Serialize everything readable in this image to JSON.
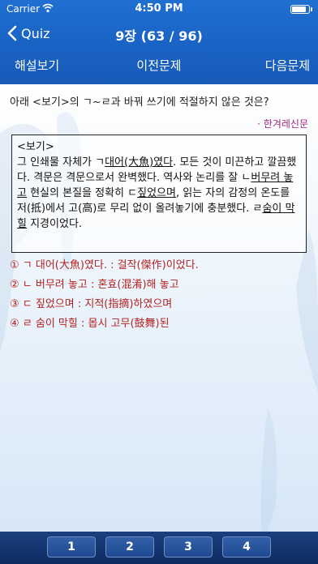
{
  "status_bar": {
    "carrier": "Carrier",
    "time": "4:50 PM"
  },
  "nav": {
    "back_label": "Quiz",
    "title": "9장 (63 / 96)"
  },
  "toolbar": {
    "explanation": "해설보기",
    "previous": "이전문제",
    "next": "다음문제"
  },
  "question": {
    "text": "아래 <보기>의 ㄱ~ㄹ과 바꿔 쓰기에 적절하지 않은 것은?",
    "source": "· 한겨레신문"
  },
  "passage": {
    "label": "<보기>",
    "p1": "그 인쇄물 자체가 ㄱ",
    "u1": "대어(大魚)였다",
    "p2": ". 모든 것이 미끈하고 깔끔했다. 격문은 격문으로서 완벽했다. 역사와 논리를 잘 ㄴ",
    "u2": "버무려 놓고",
    "p3": " 현실의 본질을 정확히 ㄷ",
    "u3": "짚었으며",
    "p4": ", 읽는 자의 감정의 온도를 저(抵)에서 고(高)로 무리 없이 올려놓기에 충분했다. ㄹ",
    "u4": "숨이 막힐",
    "p5": " 지경이었다."
  },
  "options": [
    "① ㄱ 대어(大魚)였다. : 걸작(傑作)이었다.",
    "② ㄴ 버무려 놓고 : 혼효(混淆)해 놓고",
    "③ ㄷ 짚었으며 : 지적(指摘)하였으며",
    "④ ㄹ 숨이 막힐 : 몹시 고무(鼓舞)된"
  ],
  "answer_buttons": [
    "1",
    "2",
    "3",
    "4"
  ],
  "colors": {
    "header": "#1a63c4",
    "source": "#a0237a",
    "options": "#b5221f",
    "bottom_bar": "#0f2c62"
  }
}
